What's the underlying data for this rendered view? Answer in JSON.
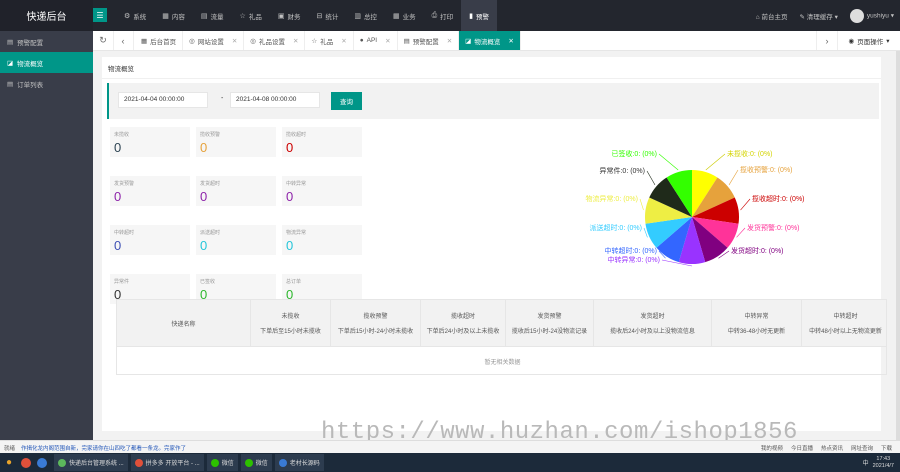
{
  "app": {
    "title": "快递后台"
  },
  "topnav": [
    {
      "icon": "gear-icon",
      "glyph": "⚙",
      "label": "系统"
    },
    {
      "icon": "table-icon",
      "glyph": "▦",
      "label": "内容"
    },
    {
      "icon": "chart-icon",
      "glyph": "▤",
      "label": "流量"
    },
    {
      "icon": "star-icon",
      "glyph": "☆",
      "label": "礼品"
    },
    {
      "icon": "finance-icon",
      "glyph": "▣",
      "label": "财务"
    },
    {
      "icon": "stats-icon",
      "glyph": "⊟",
      "label": "统计"
    },
    {
      "icon": "overview-icon",
      "glyph": "▥",
      "label": "总控"
    },
    {
      "icon": "business-icon",
      "glyph": "▦",
      "label": "业务"
    },
    {
      "icon": "print-icon",
      "glyph": "⎙",
      "label": "打印"
    },
    {
      "icon": "warning-chart-icon",
      "glyph": "▮",
      "label": "预警"
    }
  ],
  "topright": {
    "home": "前台主页",
    "clear_cache": "清理缓存",
    "username": "yushiyu"
  },
  "sidebar": {
    "items": [
      {
        "icon": "doc-icon",
        "glyph": "▤",
        "label": "预警配置"
      },
      {
        "icon": "chart-icon",
        "glyph": "◪",
        "label": "物流概览"
      },
      {
        "icon": "list-icon",
        "glyph": "▤",
        "label": "订单列表"
      }
    ]
  },
  "tabs": [
    {
      "glyph": "▦",
      "label": "后台首页",
      "closable": false
    },
    {
      "glyph": "◎",
      "label": "网站设置",
      "closable": true
    },
    {
      "glyph": "◎",
      "label": "礼品设置",
      "closable": true
    },
    {
      "glyph": "☆",
      "label": "礼品",
      "closable": true
    },
    {
      "glyph": "●",
      "label": "API",
      "closable": true
    },
    {
      "glyph": "▤",
      "label": "预警配置",
      "closable": true
    },
    {
      "glyph": "◪",
      "label": "物流概览",
      "closable": true
    }
  ],
  "page_ops": "页面操作",
  "card": {
    "title": "物流概览"
  },
  "search": {
    "start_date": "2021-04-04 00:00:00",
    "dash": "-",
    "end_date": "2021-04-08 00:00:00",
    "button": "查询"
  },
  "stats": [
    {
      "label": "未揽收",
      "value": "0",
      "color": "#2f4554"
    },
    {
      "label": "揽收预警",
      "value": "0",
      "color": "#e6a23c"
    },
    {
      "label": "揽收超时",
      "value": "0",
      "color": "#cc0000"
    },
    {
      "label": "发货预警",
      "value": "0",
      "color": "#8e24aa"
    },
    {
      "label": "发货超时",
      "value": "0",
      "color": "#8e24aa"
    },
    {
      "label": "中转异常",
      "value": "0",
      "color": "#8e24aa"
    },
    {
      "label": "中转超时",
      "value": "0",
      "color": "#3f51b5"
    },
    {
      "label": "派送超时",
      "value": "0",
      "color": "#26c6da"
    },
    {
      "label": "物流异常",
      "value": "0",
      "color": "#26c6da"
    },
    {
      "label": "异常件",
      "value": "0",
      "color": "#333333"
    },
    {
      "label": "已签收",
      "value": "0",
      "color": "#2eb82e"
    },
    {
      "label": "总订单",
      "value": "0",
      "color": "#2eb82e"
    }
  ],
  "chart_data": {
    "type": "pie",
    "slices": [
      {
        "label": "未揽收:0: (0%)",
        "value": 0,
        "color": "#ffff00"
      },
      {
        "label": "揽收预警:0: (0%)",
        "value": 0,
        "color": "#e6a23c"
      },
      {
        "label": "揽收超时:0: (0%)",
        "value": 0,
        "color": "#cc0000"
      },
      {
        "label": "发货预警:0: (0%)",
        "value": 0,
        "color": "#ff3399"
      },
      {
        "label": "发货超时:0: (0%)",
        "value": 0,
        "color": "#800080"
      },
      {
        "label": "中转异常:0: (0%)",
        "value": 0,
        "color": "#9933ff"
      },
      {
        "label": "中转超时:0: (0%)",
        "value": 0,
        "color": "#3366ff"
      },
      {
        "label": "派送超时:0: (0%)",
        "value": 0,
        "color": "#33ccff"
      },
      {
        "label": "物流异常:0: (0%)",
        "value": 0,
        "color": "#eeee44"
      },
      {
        "label": "异常件:0: (0%)",
        "value": 0,
        "color": "#1f2a1a"
      },
      {
        "label": "已签收:0: (0%)",
        "value": 0,
        "color": "#33ff00"
      }
    ]
  },
  "table": {
    "columns": [
      {
        "title": "快递名称",
        "sub": ""
      },
      {
        "title": "未揽收",
        "sub": "下单后至15小时未揽收"
      },
      {
        "title": "揽收预警",
        "sub": "下单后15小时-24小时未揽收"
      },
      {
        "title": "揽收超时",
        "sub": "下单后24小时及以上未揽收"
      },
      {
        "title": "发货预警",
        "sub": "揽收后15小时-24没物流记录"
      },
      {
        "title": "发货超时",
        "sub": "揽收后24小时及以上没物流信息"
      },
      {
        "title": "中转异常",
        "sub": "中转36-48小时无更新"
      },
      {
        "title": "中转超时",
        "sub": "中转48小时以上无物流更新"
      }
    ],
    "empty": "暂无相关数据"
  },
  "watermark": "https://www.huzhan.com/ishop1856",
  "browser_status": {
    "left": "就绪",
    "news": "作揖化龙内阁范围自新，完家请你在山四吃了都看一条龙。完家作了",
    "right": [
      "我的视频",
      "今日直播",
      "热点资讯",
      "网址查询",
      "下载"
    ]
  },
  "taskbar": {
    "apps": [
      {
        "label": "快递后台管理系统 ...",
        "color": "#5cb85c"
      },
      {
        "label": "拼多多 开放平台 - ...",
        "color": "#e0503a"
      },
      {
        "label": "微信",
        "color": "#2dc100"
      },
      {
        "label": "微信",
        "color": "#2dc100"
      },
      {
        "label": "老村长源码",
        "color": "#3a7bd5"
      }
    ],
    "ime": "中",
    "time": "17:43",
    "date": "2021/4/7"
  }
}
